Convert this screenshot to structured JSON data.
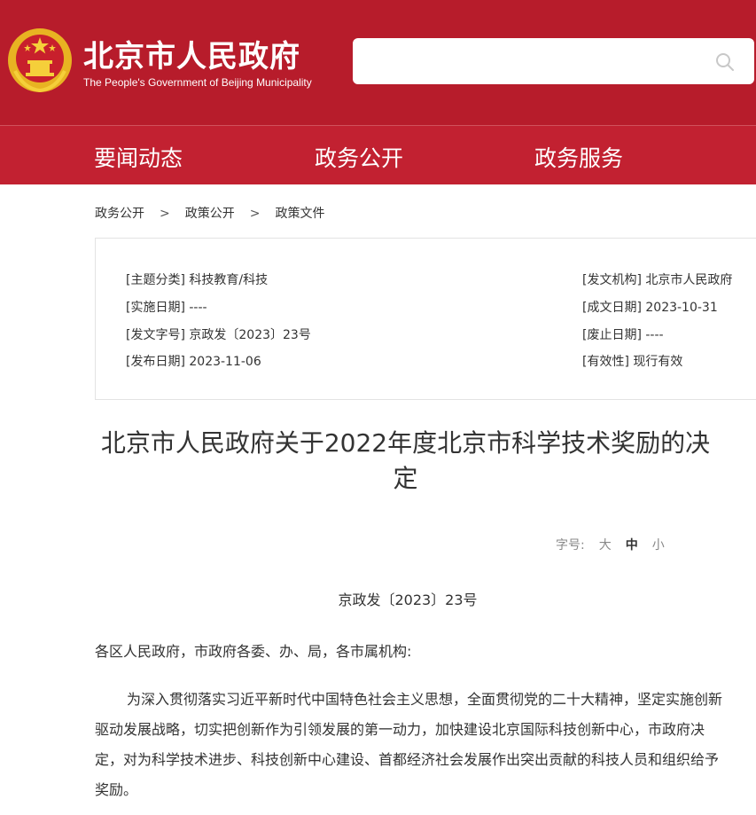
{
  "colors": {
    "header_bg": "#b71c2b",
    "nav_bg": "#c22131",
    "text": "#333333",
    "muted": "#888888"
  },
  "header": {
    "title": "北京市人民政府",
    "subtitle": "The People's Government of Beijing Municipality",
    "emblem_icon": "national-emblem-icon",
    "search": {
      "value": "",
      "placeholder": "",
      "icon": "search-icon"
    }
  },
  "nav": {
    "items": [
      "要闻动态",
      "政务公开",
      "政务服务"
    ]
  },
  "breadcrumb": {
    "items": [
      "政务公开",
      "政策公开",
      "政策文件"
    ],
    "separator": ">"
  },
  "meta": {
    "subject": "[主题分类] 科技教育/科技",
    "effective_date": "[实施日期] ----",
    "doc_no": "[发文字号] 京政发〔2023〕23号",
    "publish_date": "[发布日期] 2023-11-06",
    "issuer": "[发文机构] 北京市人民政府",
    "written_date": "[成文日期] 2023-10-31",
    "abolish_date": "[废止日期] ----",
    "validity": "[有效性] 现行有效"
  },
  "document": {
    "title": "北京市人民政府关于2022年度北京市科学技术奖励的决定",
    "font_label": "字号:",
    "font_sizes": [
      "大",
      "中",
      "小"
    ],
    "font_selected": "中",
    "number": "京政发〔2023〕23号",
    "salutation": "各区人民政府，市政府各委、办、局，各市属机构:",
    "paragraph": "为深入贯彻落实习近平新时代中国特色社会主义思想，全面贯彻党的二十大精神，坚定实施创新驱动发展战略，切实把创新作为引领发展的第一动力，加快建设北京国际科技创新中心，市政府决定，对为科学技术进步、科技创新中心建设、首都经济社会发展作出突出贡献的科技人员和组织给予奖励。"
  }
}
